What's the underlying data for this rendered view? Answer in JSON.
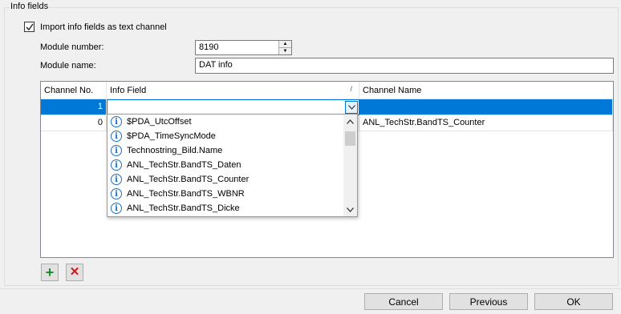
{
  "group": {
    "title": "Info fields"
  },
  "import_checkbox": {
    "label": "Import info fields as text channel",
    "checked": true
  },
  "module_number": {
    "label": "Module number:",
    "value": "8190"
  },
  "module_name": {
    "label": "Module name:",
    "value": "DAT info"
  },
  "grid": {
    "columns": [
      "Channel No.",
      "Info Field",
      "Channel Name"
    ],
    "rows": [
      {
        "channel_no": "1",
        "info_field": "",
        "channel_name": ""
      },
      {
        "channel_no": "0",
        "info_field": "",
        "channel_name": "ANL_TechStr.BandTS_Counter"
      }
    ]
  },
  "dropdown": {
    "items": [
      "$PDA_UtcOffset",
      "$PDA_TimeSyncMode",
      "Technostring_Bild.Name",
      "ANL_TechStr.BandTS_Daten",
      "ANL_TechStr.BandTS_Counter",
      "ANL_TechStr.BandTS_WBNR",
      "ANL_TechStr.BandTS_Dicke"
    ]
  },
  "buttons": {
    "add": "+",
    "delete": "✕",
    "cancel": "Cancel",
    "previous": "Previous",
    "ok": "OK"
  },
  "colors": {
    "selection": "#0078d7",
    "add": "#1e8a2e",
    "delete": "#d01818",
    "info_icon": "#1a6fc4"
  }
}
